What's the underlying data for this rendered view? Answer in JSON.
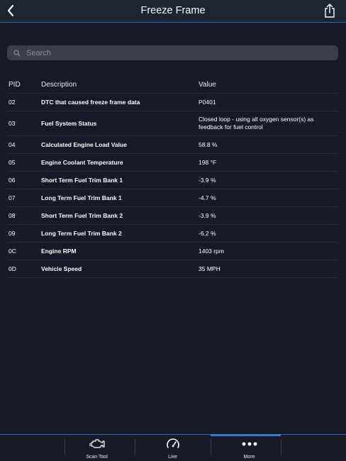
{
  "header": {
    "title": "Freeze Frame",
    "back_icon": "chevron-left-icon",
    "share_icon": "share-icon"
  },
  "search": {
    "placeholder": "Search",
    "value": ""
  },
  "table": {
    "columns": {
      "pid": "PID",
      "description": "Description",
      "value": "Value"
    },
    "rows": [
      {
        "pid": "02",
        "description": "DTC that caused freeze frame data",
        "value": "P0401"
      },
      {
        "pid": "03",
        "description": "Fuel System Status",
        "value": "Closed loop - using all oxygen sensor(s) as feedback for fuel control"
      },
      {
        "pid": "04",
        "description": "Calculated Engine Load Value",
        "value": "58.8 %"
      },
      {
        "pid": "05",
        "description": "Engine Coolant Temperature",
        "value": "198 °F"
      },
      {
        "pid": "06",
        "description": "Short Term Fuel Trim Bank 1",
        "value": "-3.9 %"
      },
      {
        "pid": "07",
        "description": "Long Term Fuel Trim Bank 1",
        "value": "-4.7 %"
      },
      {
        "pid": "08",
        "description": "Short Term Fuel Trim Bank 2",
        "value": "-3.9 %"
      },
      {
        "pid": "09",
        "description": "Long Term Fuel Trim Bank 2",
        "value": "-6.2 %"
      },
      {
        "pid": "0C",
        "description": "Engine RPM",
        "value": "1403 rpm"
      },
      {
        "pid": "0D",
        "description": "Vehicle Speed",
        "value": "35 MPH"
      }
    ]
  },
  "tabbar": {
    "tabs": [
      {
        "label": "Scan Tool",
        "icon": "engine-icon"
      },
      {
        "label": "Live",
        "icon": "gauge-icon"
      },
      {
        "label": "More",
        "icon": "more-icon",
        "active": true
      }
    ]
  },
  "colors": {
    "accent": "#2f7fd0",
    "background": "#161a26",
    "navbar": "#1f2431"
  }
}
